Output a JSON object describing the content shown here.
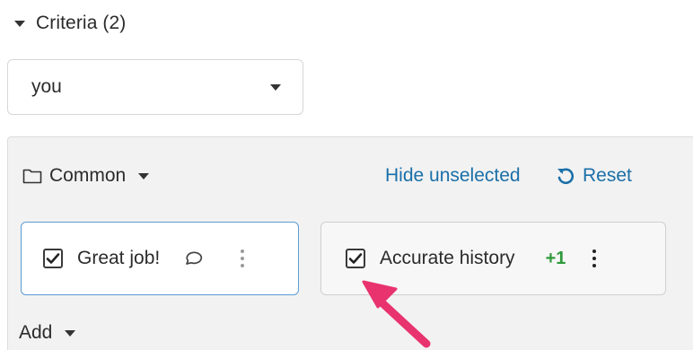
{
  "criteria": {
    "title": "Criteria (2)",
    "toggle_icon": "caret-down-icon"
  },
  "select": {
    "value": "you",
    "icon": "caret-down-icon"
  },
  "panel": {
    "group_icon": "folder-icon",
    "group_label": "Common",
    "hide_unselected": "Hide unselected",
    "reset_icon": "undo-icon",
    "reset_label": "Reset"
  },
  "cards": [
    {
      "label": "Great job!",
      "checked": true,
      "icons": [
        "check-icon",
        "comment-icon",
        "kebab-menu-icon"
      ]
    },
    {
      "label": "Accurate history",
      "checked": true,
      "count": "+1",
      "icons": [
        "check-icon",
        "kebab-menu-icon"
      ]
    }
  ],
  "add": {
    "label": "Add",
    "icon": "caret-down-icon"
  },
  "annotation": {
    "icon": "pointer-arrow-icon",
    "color": "#e8336f"
  },
  "colors": {
    "link": "#1a6fa8",
    "selected_border": "#5b9bd5",
    "count": "#2f9a3b",
    "panel_bg": "#f2f2f2"
  }
}
